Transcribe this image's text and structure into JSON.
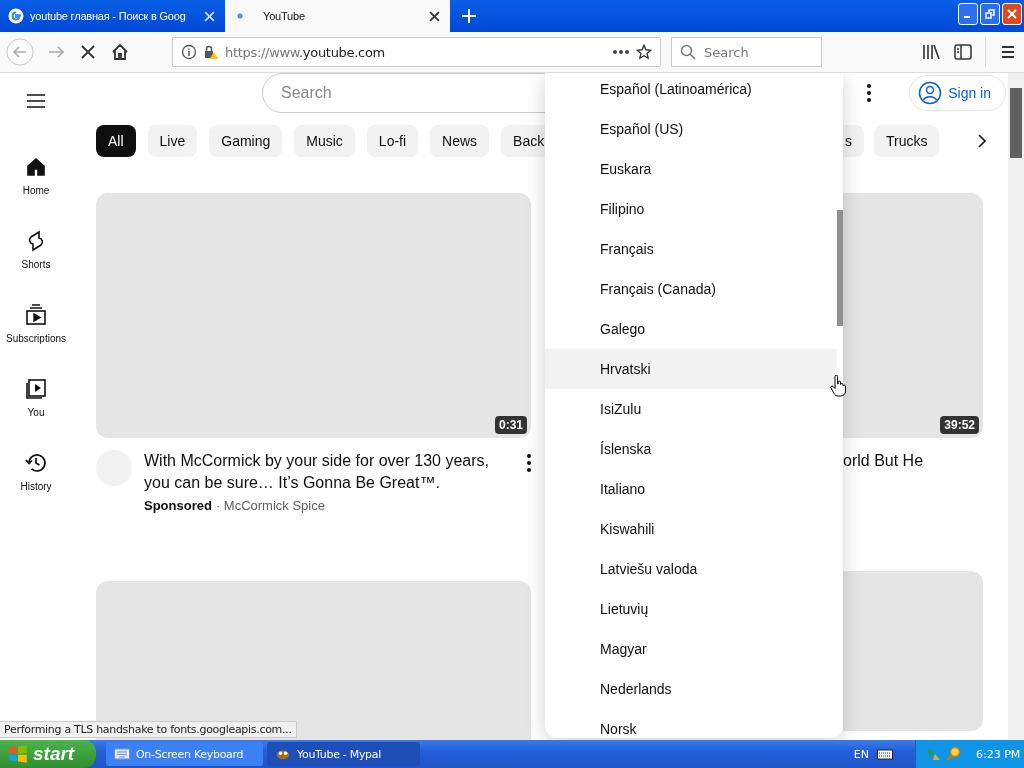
{
  "browser": {
    "tabs": [
      {
        "title": "youtube главная - Поиск в Goog",
        "selected": false
      },
      {
        "title": "YouTube",
        "selected": true
      }
    ],
    "url_host_prefix": "https://www.",
    "url_host": "youtube.com",
    "search_placeholder": "Search",
    "status": "Performing a TLS handshake to fonts.googleapis.com..."
  },
  "page": {
    "search_placeholder": "Search",
    "sign_in": "Sign in",
    "sidebar": [
      {
        "label": "Home",
        "selected": true
      },
      {
        "label": "Shorts",
        "selected": false
      },
      {
        "label": "Subscriptions",
        "selected": false
      },
      {
        "label": "You",
        "selected": false
      },
      {
        "label": "History",
        "selected": false
      }
    ],
    "chips": [
      {
        "label": "All",
        "selected": true
      },
      {
        "label": "Live",
        "selected": false
      },
      {
        "label": "Gaming",
        "selected": false
      },
      {
        "label": "Music",
        "selected": false
      },
      {
        "label": "Lo-fi",
        "selected": false
      },
      {
        "label": "News",
        "selected": false
      },
      {
        "label": "Back",
        "selected": false
      }
    ],
    "chips_right": [
      {
        "label": "s",
        "selected": false
      },
      {
        "label": "Trucks",
        "selected": false
      }
    ],
    "video": {
      "duration": "0:31",
      "title": "With McCormick by your side for over 130 years, you can be sure… It’s Gonna Be Great™.",
      "sponsored": "Sponsored",
      "channel": "· McCormick Spice"
    },
    "video_right": {
      "duration": "39:52",
      "title": "orld But He"
    }
  },
  "language_menu": {
    "items": [
      {
        "label": "Español (Latinoamérica)",
        "hovered": false
      },
      {
        "label": "Español (US)",
        "hovered": false
      },
      {
        "label": "Euskara",
        "hovered": false
      },
      {
        "label": "Filipino",
        "hovered": false
      },
      {
        "label": "Français",
        "hovered": false
      },
      {
        "label": "Français (Canada)",
        "hovered": false
      },
      {
        "label": "Galego",
        "hovered": false
      },
      {
        "label": "Hrvatski",
        "hovered": true
      },
      {
        "label": "IsiZulu",
        "hovered": false
      },
      {
        "label": "Íslenska",
        "hovered": false
      },
      {
        "label": "Italiano",
        "hovered": false
      },
      {
        "label": "Kiswahili",
        "hovered": false
      },
      {
        "label": "Latviešu valoda",
        "hovered": false
      },
      {
        "label": "Lietuvių",
        "hovered": false
      },
      {
        "label": "Magyar",
        "hovered": false
      },
      {
        "label": "Nederlands",
        "hovered": false
      },
      {
        "label": "Norsk",
        "hovered": false
      }
    ]
  },
  "taskbar": {
    "start": "start",
    "tasks": [
      {
        "label": "On-Screen Keyboard",
        "selected": false
      },
      {
        "label": "YouTube - Mypal",
        "selected": true
      }
    ],
    "language": "EN",
    "clock": "6:23 PM"
  }
}
